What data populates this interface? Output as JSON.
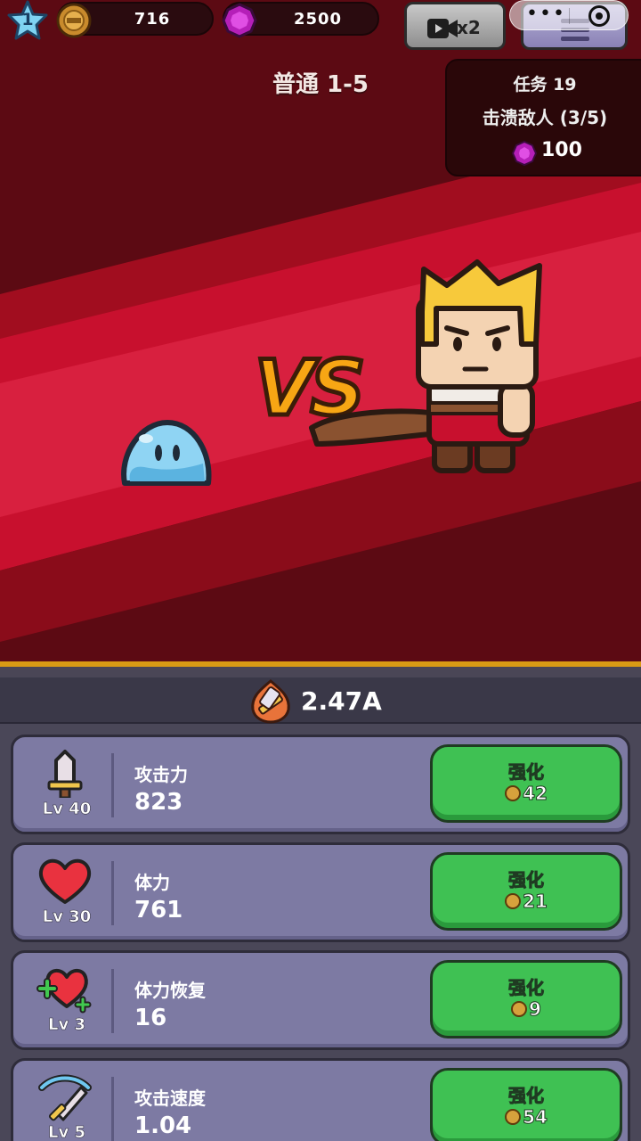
{
  "player": {
    "level": "1"
  },
  "resources": {
    "coins": "716",
    "gems": "2500"
  },
  "buttons": {
    "speed_label": "x2"
  },
  "stage": {
    "title": "普通 1-5",
    "vs": "VS"
  },
  "quest": {
    "title": "任务 19",
    "description": "击溃敌人 (3/5)",
    "reward": "100"
  },
  "dps": {
    "value": "2.47A"
  },
  "upgrades": [
    {
      "icon": "sword-icon",
      "level": "Lv 40",
      "name": "攻击力",
      "value": "823",
      "button": "强化",
      "cost": "42"
    },
    {
      "icon": "heart-icon",
      "level": "Lv 30",
      "name": "体力",
      "value": "761",
      "button": "强化",
      "cost": "21"
    },
    {
      "icon": "heart-plus-icon",
      "level": "Lv 3",
      "name": "体力恢复",
      "value": "16",
      "button": "强化",
      "cost": "9"
    },
    {
      "icon": "attack-speed-icon",
      "level": "Lv 5",
      "name": "攻击速度",
      "value": "1.04",
      "button": "强化",
      "cost": "54"
    }
  ],
  "colors": {
    "upgrade_button": "#3fc153",
    "row_background": "#7d7aa3",
    "battle_red": "#c8102e",
    "vs_orange": "#f7a614",
    "divider_gold": "#d99a14"
  }
}
